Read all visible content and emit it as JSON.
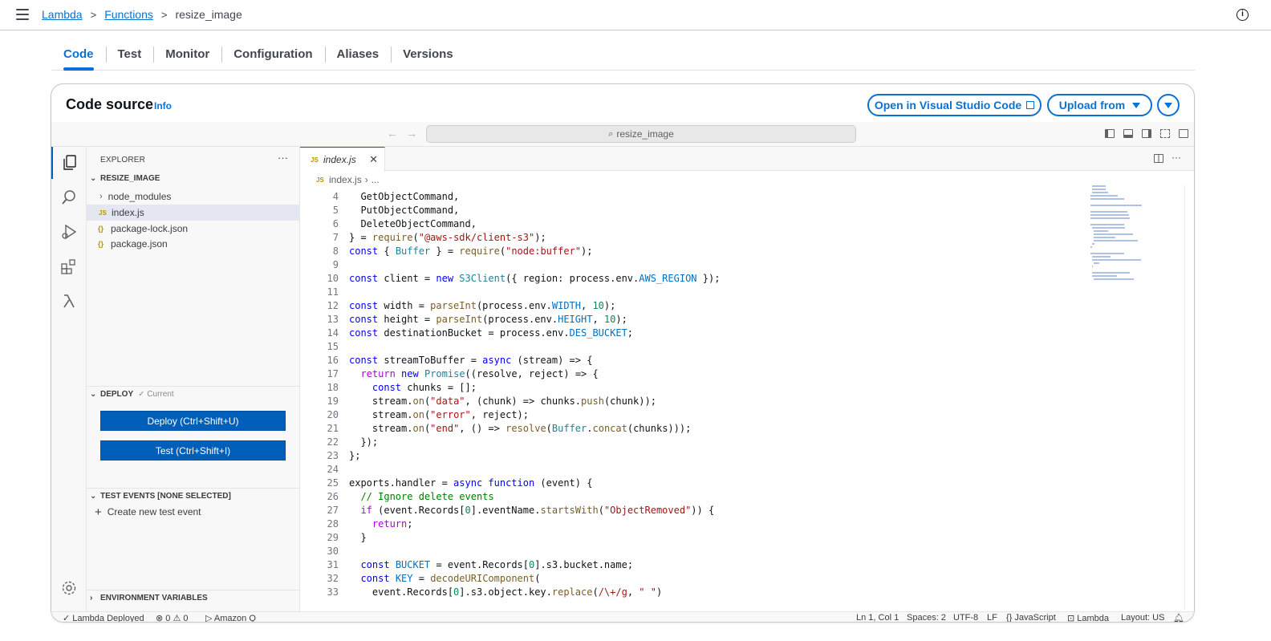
{
  "breadcrumbs": {
    "lambda": "Lambda",
    "functions": "Functions",
    "current": "resize_image"
  },
  "tabs": [
    "Code",
    "Test",
    "Monitor",
    "Configuration",
    "Aliases",
    "Versions"
  ],
  "card": {
    "title": "Code source",
    "info": "Info",
    "open_vscode": "Open in Visual Studio Code",
    "upload_from": "Upload from"
  },
  "ide": {
    "command_center": "resize_image",
    "explorer_title": "EXPLORER",
    "folder": "RESIZE_IMAGE",
    "files": [
      {
        "name": "node_modules",
        "type": "folder"
      },
      {
        "name": "index.js",
        "type": "js"
      },
      {
        "name": "package-lock.json",
        "type": "json"
      },
      {
        "name": "package.json",
        "type": "json"
      }
    ],
    "deploy_section": "DEPLOY",
    "deploy_status": "✓ Current",
    "deploy_button": "Deploy (Ctrl+Shift+U)",
    "test_button": "Test (Ctrl+Shift+I)",
    "test_events_section": "TEST EVENTS [NONE SELECTED]",
    "create_test_event": "Create new test event",
    "env_vars_section": "ENVIRONMENT VARIABLES",
    "editor_tab": "index.js",
    "editor_breadcrumb_file": "index.js",
    "editor_breadcrumb_more": "...",
    "code_lines": [
      {
        "n": "4",
        "t": "  GetObjectCommand,"
      },
      {
        "n": "5",
        "t": "  PutObjectCommand,"
      },
      {
        "n": "6",
        "t": "  DeleteObjectCommand,"
      },
      {
        "n": "7",
        "t": "} = require(\"@aws-sdk/client-s3\");"
      },
      {
        "n": "8",
        "t": "const { Buffer } = require(\"node:buffer\");"
      },
      {
        "n": "9",
        "t": ""
      },
      {
        "n": "10",
        "t": "const client = new S3Client({ region: process.env.AWS_REGION });"
      },
      {
        "n": "11",
        "t": ""
      },
      {
        "n": "12",
        "t": "const width = parseInt(process.env.WIDTH, 10);"
      },
      {
        "n": "13",
        "t": "const height = parseInt(process.env.HEIGHT, 10);"
      },
      {
        "n": "14",
        "t": "const destinationBucket = process.env.DES_BUCKET;"
      },
      {
        "n": "15",
        "t": ""
      },
      {
        "n": "16",
        "t": "const streamToBuffer = async (stream) => {"
      },
      {
        "n": "17",
        "t": "  return new Promise((resolve, reject) => {"
      },
      {
        "n": "18",
        "t": "    const chunks = [];"
      },
      {
        "n": "19",
        "t": "    stream.on(\"data\", (chunk) => chunks.push(chunk));"
      },
      {
        "n": "20",
        "t": "    stream.on(\"error\", reject);"
      },
      {
        "n": "21",
        "t": "    stream.on(\"end\", () => resolve(Buffer.concat(chunks)));"
      },
      {
        "n": "22",
        "t": "  });"
      },
      {
        "n": "23",
        "t": "};"
      },
      {
        "n": "24",
        "t": ""
      },
      {
        "n": "25",
        "t": "exports.handler = async function (event) {"
      },
      {
        "n": "26",
        "t": "  // Ignore delete events"
      },
      {
        "n": "27",
        "t": "  if (event.Records[0].eventName.startsWith(\"ObjectRemoved\")) {"
      },
      {
        "n": "28",
        "t": "    return;"
      },
      {
        "n": "29",
        "t": "  }"
      },
      {
        "n": "30",
        "t": ""
      },
      {
        "n": "31",
        "t": "  const BUCKET = event.Records[0].s3.bucket.name;"
      },
      {
        "n": "32",
        "t": "  const KEY = decodeURIComponent("
      },
      {
        "n": "33",
        "t": "    event.Records[0].s3.object.key.replace(/\\+/g, \" \")"
      }
    ],
    "status": {
      "deployed": "Lambda Deployed",
      "errors": "0",
      "warnings": "0",
      "amazon_q": "Amazon Q",
      "position": "Ln 1, Col 1",
      "spaces": "Spaces: 2",
      "encoding": "UTF-8",
      "eol": "LF",
      "language": "JavaScript",
      "lambda": "Lambda",
      "layout": "Layout: US"
    }
  },
  "colors": {
    "accent": "#0972d3",
    "deploy_button": "#005fb8"
  }
}
